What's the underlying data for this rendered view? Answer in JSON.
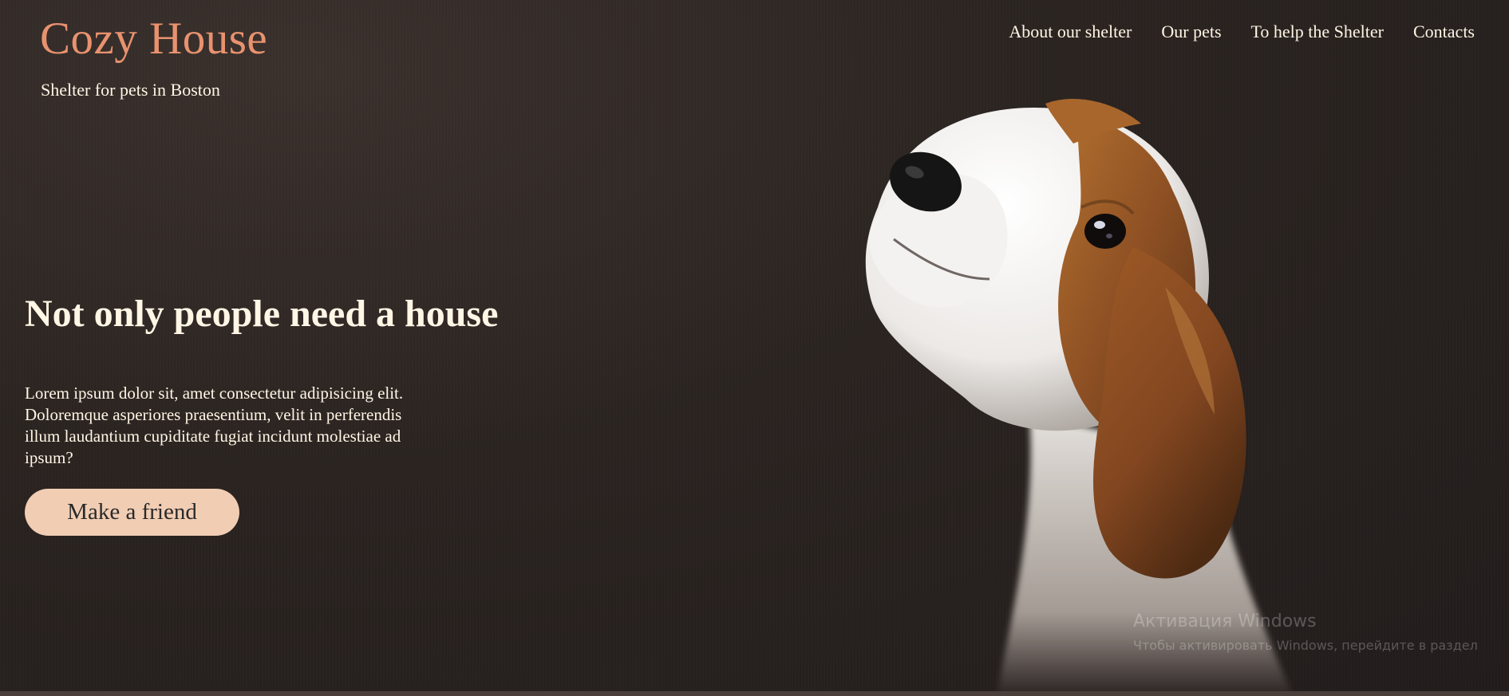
{
  "header": {
    "logo": "Cozy House",
    "subtitle": "Shelter for pets in Boston",
    "nav": [
      {
        "label": "About our shelter"
      },
      {
        "label": "Our pets"
      },
      {
        "label": "To help the Shelter"
      },
      {
        "label": "Contacts"
      }
    ]
  },
  "hero": {
    "title": "Not only people need a house",
    "text": "Lorem ipsum dolor sit, amet consectetur adipisicing elit. Doloremque asperiores praesentium, velit in perferendis illum laudantium cupiditate fugiat incidunt molestiae ad ipsum?",
    "button_label": "Make a friend"
  },
  "watermark": {
    "title": "Активация Windows",
    "text": "Чтобы активировать Windows, перейдите в раздел"
  },
  "colors": {
    "accent": "#e8926f",
    "button": "#f1cdb3",
    "text": "#fff6e5",
    "background": "#292120"
  }
}
